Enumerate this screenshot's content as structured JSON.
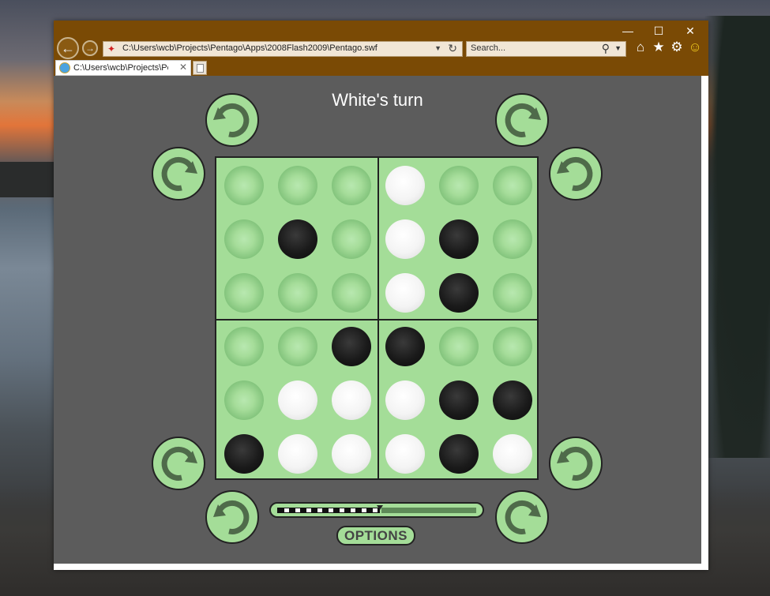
{
  "browser": {
    "address": "C:\\Users\\wcb\\Projects\\Pentago\\Apps\\2008Flash2009\\Pentago.swf",
    "search_placeholder": "Search...",
    "tab_label": "C:\\Users\\wcb\\Projects\\Pent...",
    "window_buttons": {
      "minimize": "—",
      "maximize": "☐",
      "close": "✕"
    },
    "accent": "#7a4a05"
  },
  "game": {
    "status": "White's turn",
    "options_label": "OPTIONS",
    "board": [
      [
        "empty",
        "empty",
        "empty",
        "white",
        "empty",
        "empty"
      ],
      [
        "empty",
        "black",
        "empty",
        "white",
        "black",
        "empty"
      ],
      [
        "empty",
        "empty",
        "empty",
        "white",
        "black",
        "empty"
      ],
      [
        "empty",
        "empty",
        "black",
        "black",
        "empty",
        "empty"
      ],
      [
        "empty",
        "white",
        "white",
        "white",
        "black",
        "black"
      ],
      [
        "black",
        "white",
        "white",
        "white",
        "black",
        "white"
      ]
    ],
    "rotate_buttons": [
      {
        "name": "rotate-top-left-counterclockwise",
        "dir": "ccw"
      },
      {
        "name": "rotate-top-left-clockwise",
        "dir": "cw"
      },
      {
        "name": "rotate-top-right-clockwise",
        "dir": "cw"
      },
      {
        "name": "rotate-top-right-counterclockwise",
        "dir": "ccw"
      },
      {
        "name": "rotate-bottom-left-clockwise",
        "dir": "cw"
      },
      {
        "name": "rotate-bottom-left-counterclockwise",
        "dir": "ccw"
      },
      {
        "name": "rotate-bottom-right-counterclockwise",
        "dir": "ccw"
      },
      {
        "name": "rotate-bottom-right-clockwise",
        "dir": "cw"
      }
    ],
    "move_slider_progress": 0.5,
    "colors": {
      "board": "#a4dd98",
      "background": "#5c5c5c",
      "arrow": "#4f6b4a"
    }
  }
}
